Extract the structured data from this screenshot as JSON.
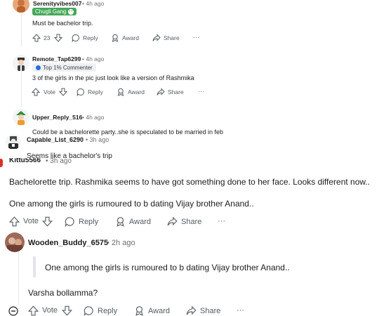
{
  "comments": [
    {
      "username": "Serenityvibes007",
      "time": "4h ago",
      "flair": "Chugli Gang",
      "body": "Must be bachelor trip.",
      "votes": "23",
      "reply": "Reply",
      "award": "Award",
      "share": "Share",
      "more": "···"
    },
    {
      "username": "Remote_Tap6299",
      "time": "4h ago",
      "flair": "Top 1% Commenter",
      "body": "3 of the girls in the pic just look like a version of Rashmika",
      "votes": "Vote",
      "reply": "Reply",
      "award": "Award",
      "share": "Share",
      "more": "···"
    },
    {
      "username": "Upper_Reply_516",
      "time": "4h ago",
      "body": "Could be a bachelorette party..she is speculated to be married in feb"
    },
    {
      "username": "Capable_List_6290",
      "time": "3h ago",
      "body": "Seems like a bachelor's trip"
    },
    {
      "username": "Kittu5566",
      "time": "3h ago",
      "body1": "Bachelorette trip. Rashmika seems to have got something done to her face. Looks different now..",
      "body2": "One among the girls is rumoured to b dating Vijay brother Anand..",
      "votes": "Vote",
      "reply": "Reply",
      "award": "Award",
      "share": "Share",
      "more": "···"
    },
    {
      "username": "Wooden_Buddy_6575",
      "time": "2h ago",
      "quote": "One among the girls is rumoured to b dating Vijay brother Anand..",
      "body": "Varsha bollamma?",
      "votes": "Vote",
      "reply": "Reply",
      "award": "Award",
      "share": "Share",
      "more": "···"
    }
  ],
  "separator": "•",
  "colors": {
    "flair_green": "#46a758",
    "meta_gray": "#6b6f73",
    "thread_line": "#e4e6e8"
  }
}
